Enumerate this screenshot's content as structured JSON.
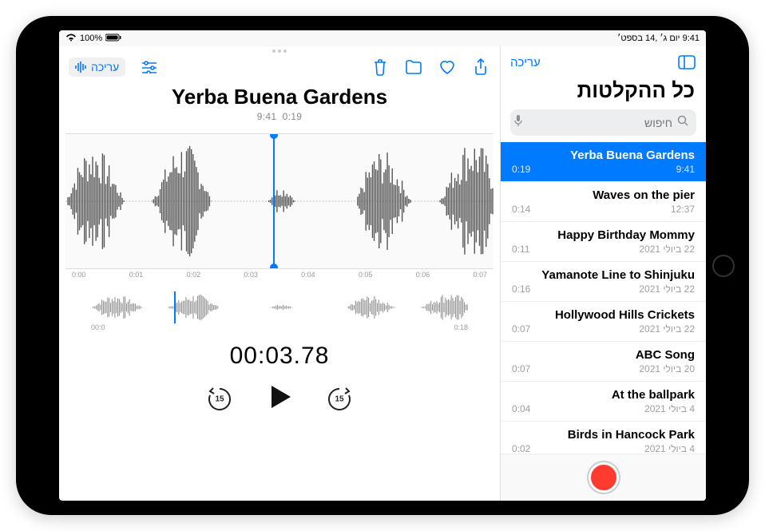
{
  "status": {
    "wifi": "wifi",
    "battery_text": "100%",
    "clock_text": "9:41 יום ג׳ ,14 בספט׳"
  },
  "sidebar": {
    "edit_label": "עריכה",
    "title": "כל ההקלטות",
    "search_placeholder": "חיפוש"
  },
  "recordings": [
    {
      "title": "Yerba Buena Gardens",
      "time": "9:41",
      "duration": "0:19",
      "selected": true
    },
    {
      "title": "Waves on the pier",
      "time": "12:37",
      "duration": "0:14"
    },
    {
      "title": "Happy Birthday Mommy",
      "time": "22 ביולי 2021",
      "duration": "0:11"
    },
    {
      "title": "Yamanote Line to Shinjuku",
      "time": "22 ביולי 2021",
      "duration": "0:16"
    },
    {
      "title": "Hollywood Hills Crickets",
      "time": "22 ביולי 2021",
      "duration": "0:07"
    },
    {
      "title": "ABC Song",
      "time": "20 ביולי 2021",
      "duration": "0:07"
    },
    {
      "title": "At the ballpark",
      "time": "4 ביולי 2021",
      "duration": "0:04"
    },
    {
      "title": "Birds in Hancock Park",
      "time": "4 ביולי 2021",
      "duration": "0:02"
    }
  ],
  "main": {
    "edit_wave_label": "עריכה",
    "title": "Yerba Buena Gardens",
    "sub_time_left": "9:41",
    "sub_time_right": "0:19",
    "current_time": "00:03.78",
    "ruler": [
      "0:00",
      "0:01",
      "0:02",
      "0:03",
      "0:04",
      "0:05",
      "0:06",
      "0:07"
    ],
    "overview_start": "00:0",
    "overview_end": "0:18",
    "skip_seconds": "15"
  }
}
